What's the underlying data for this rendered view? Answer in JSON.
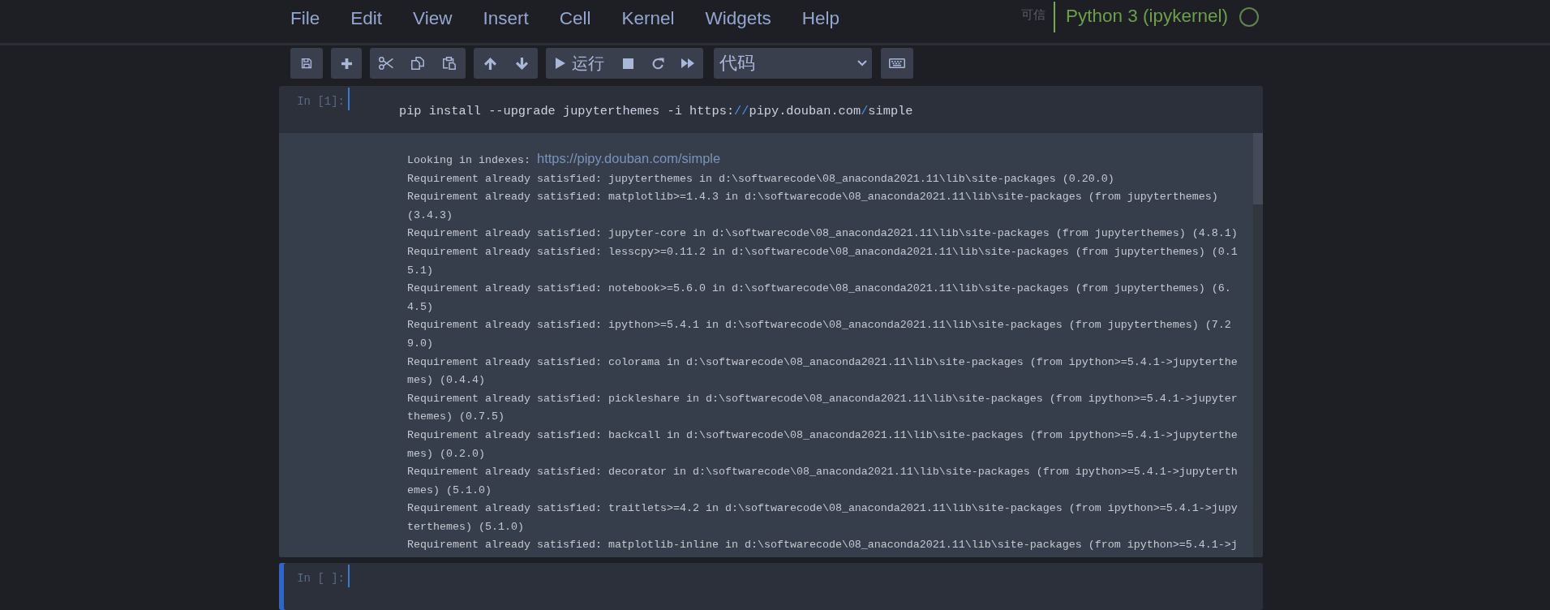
{
  "menu_bar": {
    "items": [
      "File",
      "Edit",
      "View",
      "Insert",
      "Cell",
      "Kernel",
      "Widgets",
      "Help"
    ],
    "trusted": "可信",
    "kernel": {
      "name": "Python 3 (ipykernel)",
      "busy": false
    }
  },
  "toolbar": {
    "run_label": "运行",
    "cell_type": "代码"
  },
  "cells": [
    {
      "prompt": "In [1]:",
      "selected": false,
      "source": [
        {
          "text": "pip install --upgrade jupyterthemes -i https:",
          "kind": "text"
        },
        {
          "text": "//",
          "kind": "operator"
        },
        {
          "text": "pipy.douban.com",
          "kind": "text"
        },
        {
          "text": "/",
          "kind": "operator"
        },
        {
          "text": "simple",
          "kind": "text"
        }
      ],
      "output": {
        "index_label": "Looking in indexes:",
        "index_url": "https://pipy.douban.com/simple",
        "lines": [
          "Requirement already satisfied: jupyterthemes in d:\\softwarecode\\08_anaconda2021.11\\lib\\site-packages (0.20.0)",
          "Requirement already satisfied: matplotlib>=1.4.3 in d:\\softwarecode\\08_anaconda2021.11\\lib\\site-packages (from jupyterthemes) (3.4.3)",
          "Requirement already satisfied: jupyter-core in d:\\softwarecode\\08_anaconda2021.11\\lib\\site-packages (from jupyterthemes) (4.8.1)",
          "Requirement already satisfied: lesscpy>=0.11.2 in d:\\softwarecode\\08_anaconda2021.11\\lib\\site-packages (from jupyterthemes) (0.15.1)",
          "Requirement already satisfied: notebook>=5.6.0 in d:\\softwarecode\\08_anaconda2021.11\\lib\\site-packages (from jupyterthemes) (6.4.5)",
          "Requirement already satisfied: ipython>=5.4.1 in d:\\softwarecode\\08_anaconda2021.11\\lib\\site-packages (from jupyterthemes) (7.29.0)",
          "Requirement already satisfied: colorama in d:\\softwarecode\\08_anaconda2021.11\\lib\\site-packages (from ipython>=5.4.1->jupyterthemes) (0.4.4)",
          "Requirement already satisfied: pickleshare in d:\\softwarecode\\08_anaconda2021.11\\lib\\site-packages (from ipython>=5.4.1->jupyterthemes) (0.7.5)",
          "Requirement already satisfied: backcall in d:\\softwarecode\\08_anaconda2021.11\\lib\\site-packages (from ipython>=5.4.1->jupyterthemes) (0.2.0)",
          "Requirement already satisfied: decorator in d:\\softwarecode\\08_anaconda2021.11\\lib\\site-packages (from ipython>=5.4.1->jupyterthemes) (5.1.0)",
          "Requirement already satisfied: traitlets>=4.2 in d:\\softwarecode\\08_anaconda2021.11\\lib\\site-packages (from ipython>=5.4.1->jupyterthemes) (5.1.0)",
          "Requirement already satisfied: matplotlib-inline in d:\\softwarecode\\08_anaconda2021.11\\lib\\site-packages (from ipython>=5.4.1->j"
        ]
      }
    },
    {
      "prompt": "In [ ]:",
      "selected": true
    }
  ]
}
